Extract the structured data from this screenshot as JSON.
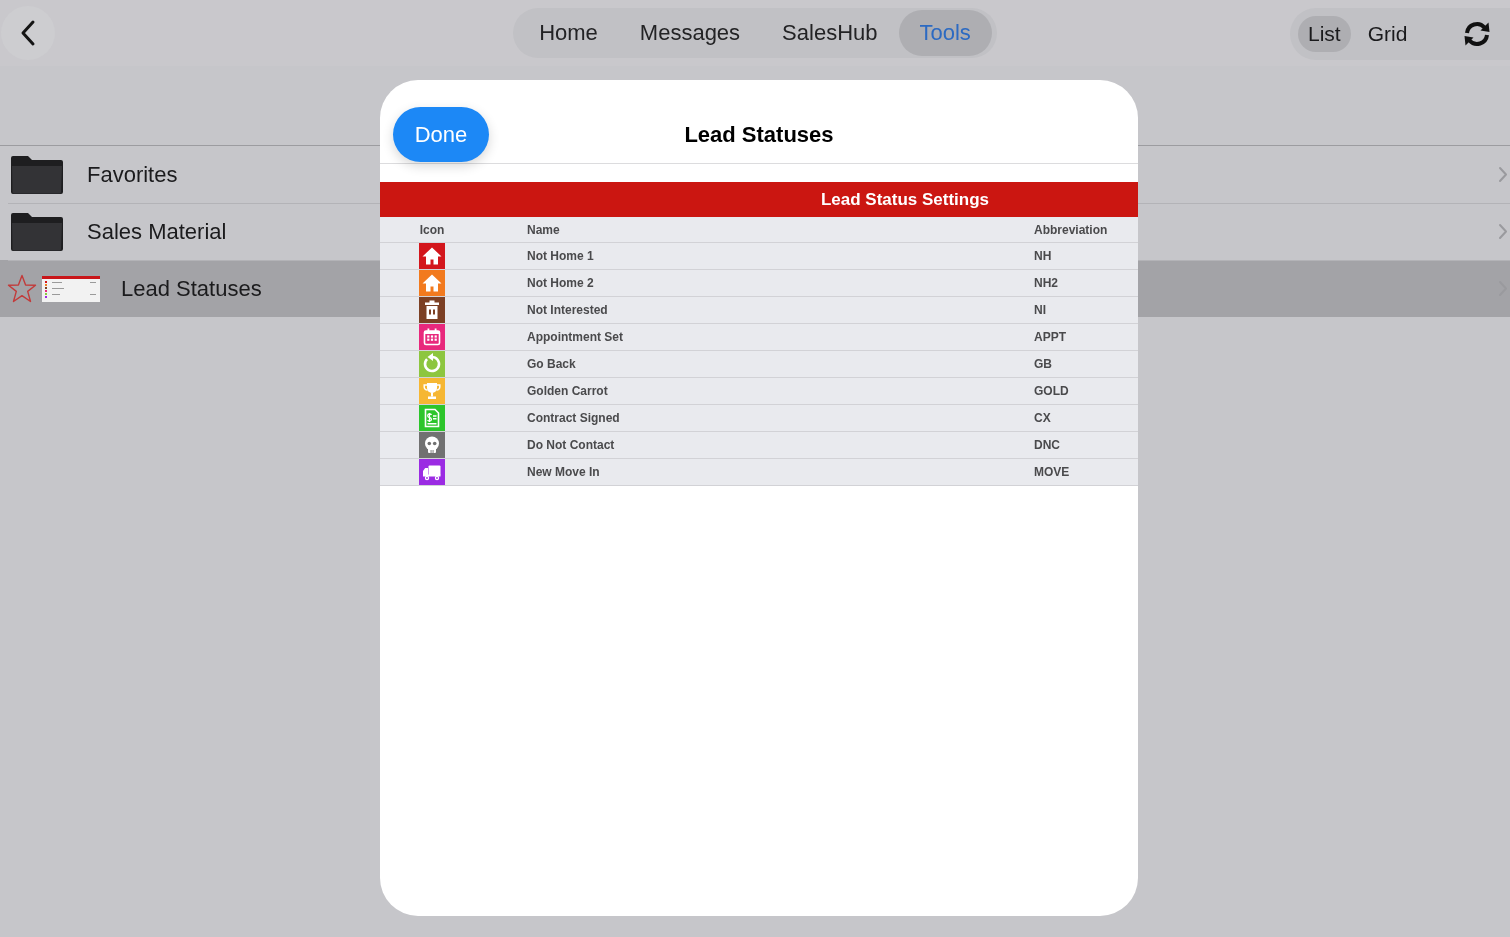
{
  "top_bar": {
    "tabs": [
      {
        "label": "Home",
        "selected": false
      },
      {
        "label": "Messages",
        "selected": false
      },
      {
        "label": "SalesHub",
        "selected": false
      },
      {
        "label": "Tools",
        "selected": true
      }
    ],
    "view_toggle": [
      {
        "label": "List",
        "selected": true
      },
      {
        "label": "Grid",
        "selected": false
      }
    ]
  },
  "library": {
    "items": [
      {
        "kind": "folder",
        "label": "Favorites",
        "selected": false
      },
      {
        "kind": "folder",
        "label": "Sales Material",
        "selected": false
      },
      {
        "kind": "document",
        "label": "Lead Statuses",
        "selected": true,
        "starred": false
      }
    ]
  },
  "modal": {
    "done_button": "Done",
    "title": "Lead Statuses",
    "table": {
      "title": "Lead Status Settings",
      "columns": [
        "Icon",
        "Name",
        "Abbreviation"
      ],
      "rows": [
        {
          "name": "Not Home 1",
          "abbreviation": "NH",
          "color": "#d3161c"
        },
        {
          "name": "Not Home 2",
          "abbreviation": "NH2",
          "color": "#f27a1e"
        },
        {
          "name": "Not Interested",
          "abbreviation": "NI",
          "color": "#7c4024"
        },
        {
          "name": "Appointment Set",
          "abbreviation": "APPT",
          "color": "#e8287c"
        },
        {
          "name": "Go Back",
          "abbreviation": "GB",
          "color": "#8dc63f"
        },
        {
          "name": "Golden Carrot",
          "abbreviation": "GOLD",
          "color": "#f6b733"
        },
        {
          "name": "Contract Signed",
          "abbreviation": "CX",
          "color": "#2cc52b"
        },
        {
          "name": "Do Not Contact",
          "abbreviation": "DNC",
          "color": "#717171"
        },
        {
          "name": "New Move In",
          "abbreviation": "MOVE",
          "color": "#9b2be3"
        }
      ]
    }
  }
}
